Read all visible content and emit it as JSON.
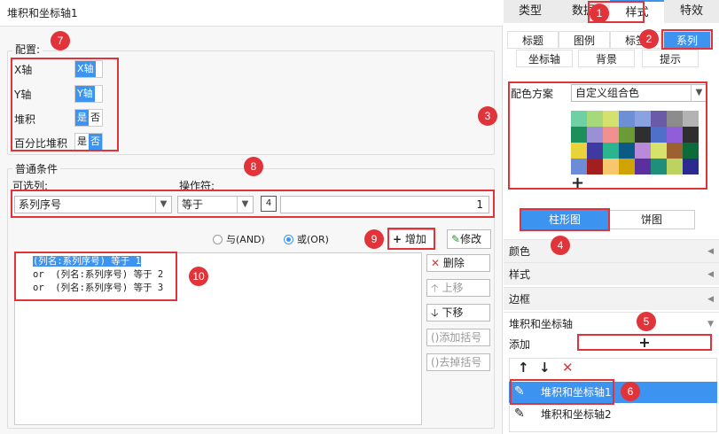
{
  "left": {
    "title": "堆积和坐标轴1",
    "config": {
      "label": "配置:",
      "rows": [
        {
          "label": "X轴",
          "options": [
            "X轴"
          ],
          "selected": 0
        },
        {
          "label": "Y轴",
          "options": [
            "Y轴"
          ],
          "selected": 0
        },
        {
          "label": "堆积",
          "options": [
            "是",
            "否"
          ],
          "selected": 0
        },
        {
          "label": "百分比堆积",
          "options": [
            "是",
            "否"
          ],
          "selected": 1
        }
      ]
    },
    "condition": {
      "label": "普通条件",
      "column_label": "可选列:",
      "operator_label": "操作符:",
      "column_value": "系列序号",
      "operator_value": "等于",
      "value_type": "4",
      "value": "1",
      "and_label": "与(AND)",
      "or_label": "或(OR)",
      "add_label": "增加",
      "modify_label": "修改",
      "delete_label": "删除",
      "up_label": "上移",
      "down_label": "下移",
      "add_bracket_label": "添加括号",
      "remove_bracket_label": "去掉括号",
      "list": [
        "(列名:系列序号) 等于 1",
        "or  (列名:系列序号) 等于 2",
        "or  (列名:系列序号) 等于 3"
      ]
    }
  },
  "right": {
    "tabs": [
      "类型",
      "数据",
      "样式",
      "特效"
    ],
    "subtabs_row1": [
      "标题",
      "图例",
      "标签",
      "系列"
    ],
    "subtabs_row2": [
      "坐标轴",
      "背景",
      "提示"
    ],
    "color_scheme_label": "配色方案",
    "color_scheme_value": "自定义组合色",
    "palette": [
      [
        "#6fd0a6",
        "#a6d97a",
        "#d4e26d",
        "#6d8fd6",
        "#8aa1e2",
        "#6a5aa8",
        "#8c8c8c",
        "#b3b3b3"
      ],
      [
        "#1c8f5b",
        "#9b8fd6",
        "#f28f8f",
        "#6b9a36",
        "#2f2f2f",
        "#4f6fc8",
        "#8f5ed8",
        "#2e2e2e"
      ],
      [
        "#e9d23a",
        "#3e3aa2",
        "#2bb58f",
        "#0b5a86",
        "#b98adb",
        "#d7e26a",
        "#9c6130",
        "#0d6b3a"
      ],
      [
        "#6e8bd8",
        "#a31f1f",
        "#f7c66e",
        "#cfa400",
        "#5a2f9e",
        "#1f8f7a",
        "#bcd35f",
        "#2a2a8f"
      ]
    ],
    "add_color_symbol": "+",
    "chart_buttons": [
      "柱形图",
      "饼图"
    ],
    "sections": [
      "颜色",
      "样式",
      "边框",
      "堆积和坐标轴"
    ],
    "add_label": "添加",
    "add_symbol": "+",
    "list_items": [
      "堆积和坐标轴1",
      "堆积和坐标轴2"
    ]
  },
  "badges": [
    "1",
    "2",
    "3",
    "4",
    "5",
    "6",
    "7",
    "8",
    "9",
    "10"
  ]
}
